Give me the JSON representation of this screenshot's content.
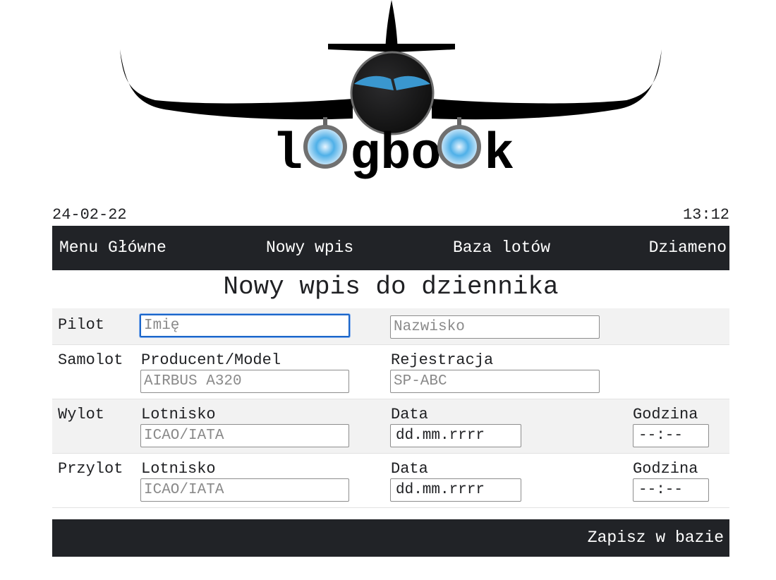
{
  "brand": {
    "logo_text": "logbook"
  },
  "header": {
    "date": "24-02-22",
    "time": "13:12"
  },
  "nav": [
    {
      "label": "Menu Główne"
    },
    {
      "label": "Nowy wpis"
    },
    {
      "label": "Baza lotów"
    },
    {
      "label": "Dziameno"
    }
  ],
  "page_title": "Nowy wpis do dziennika",
  "form": {
    "pilot": {
      "label": "Pilot",
      "first_name_placeholder": "Imię",
      "last_name_placeholder": "Nazwisko"
    },
    "aircraft": {
      "label": "Samolot",
      "model_label": "Producent/Model",
      "model_placeholder": "AIRBUS A320",
      "registration_label": "Rejestracja",
      "registration_placeholder": "SP-ABC"
    },
    "departure": {
      "label": "Wylot",
      "airport_label": "Lotnisko",
      "airport_placeholder": "ICAO/IATA",
      "date_label": "Data",
      "date_value": "dd.mm.rrrr",
      "time_label": "Godzina",
      "time_value": "--:--"
    },
    "arrival": {
      "label": "Przylot",
      "airport_label": "Lotnisko",
      "airport_placeholder": "ICAO/IATA",
      "date_label": "Data",
      "date_value": "dd.mm.rrrr",
      "time_label": "Godzina",
      "time_value": "--:--"
    }
  },
  "footer": {
    "save_label": "Zapisz w bazie"
  },
  "colors": {
    "dark": "#212327",
    "accent_blue": "#3a97cf",
    "focus": "#1b66c9"
  }
}
